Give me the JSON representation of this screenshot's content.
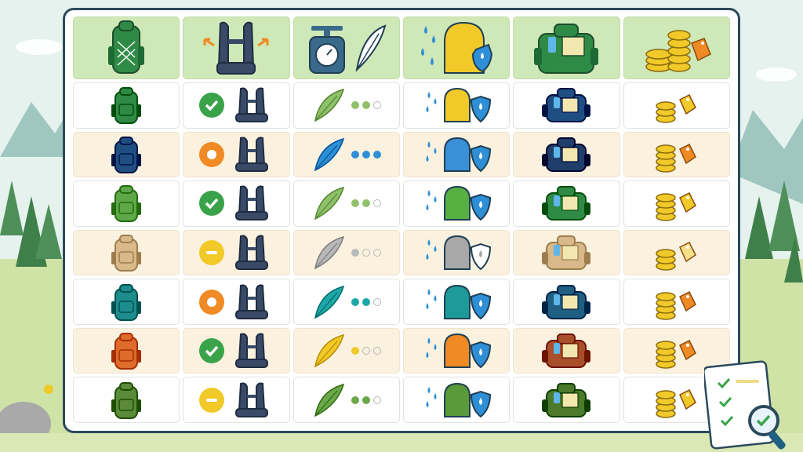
{
  "columns": [
    {
      "icon": "backpack-icon",
      "accent": "#2f8a46"
    },
    {
      "icon": "harness-icon",
      "accent": "#f08a24"
    },
    {
      "icon": "scale-feather-icon",
      "accent": "#2b4a5c"
    },
    {
      "icon": "rain-cover-icon",
      "accent": "#2e8fd6"
    },
    {
      "icon": "pocket-icon",
      "accent": "#2f8a46"
    },
    {
      "icon": "coins-price-tag-icon",
      "accent": "#f0c32a"
    }
  ],
  "rows": [
    {
      "pack_color": "#2f8a46",
      "fit": "good",
      "weight_color": "#8fc06a",
      "weight_level": 2,
      "cover_color": "#f1c928",
      "pocket_color": "#1f4f82",
      "cost_level": 2,
      "tag_color": "#f1c928"
    },
    {
      "pack_color": "#1f4f82",
      "fit": "poor",
      "weight_color": "#2e8fd6",
      "weight_level": 3,
      "cover_color": "#3a8fd6",
      "pocket_color": "#1f3f6a",
      "cost_level": 3,
      "tag_color": "#f08a24"
    },
    {
      "pack_color": "#5ea84a",
      "fit": "good",
      "weight_color": "#8fc06a",
      "weight_level": 2,
      "cover_color": "#58b043",
      "pocket_color": "#2f8a46",
      "cost_level": 3,
      "tag_color": "#f1c928"
    },
    {
      "pack_color": "#d9b98a",
      "fit": "neutral",
      "weight_color": "#b8b8b8",
      "weight_level": 1,
      "cover_color": "#a8a8a8",
      "pocket_color": "#d9b98a",
      "cost_level": 2,
      "tag_color": "#f5e08a"
    },
    {
      "pack_color": "#1e8c8c",
      "fit": "poor",
      "weight_color": "#1ea7a7",
      "weight_level": 2,
      "cover_color": "#1e9a9a",
      "pocket_color": "#1f5f82",
      "cost_level": 3,
      "tag_color": "#f08a24"
    },
    {
      "pack_color": "#e06a2a",
      "fit": "good",
      "weight_color": "#f1c928",
      "weight_level": 1,
      "cover_color": "#f08a24",
      "pocket_color": "#a94f2a",
      "cost_level": 3,
      "tag_color": "#f08a24"
    },
    {
      "pack_color": "#5a8a3a",
      "fit": "neutral",
      "weight_color": "#6aa84a",
      "weight_level": 2,
      "cover_color": "#5a9a3a",
      "pocket_color": "#4a7a2a",
      "cost_level": 3,
      "tag_color": "#f1c928"
    }
  ],
  "status_colors": {
    "good": "#3aa34a",
    "poor": "#f08a24",
    "neutral": "#f1c928"
  }
}
